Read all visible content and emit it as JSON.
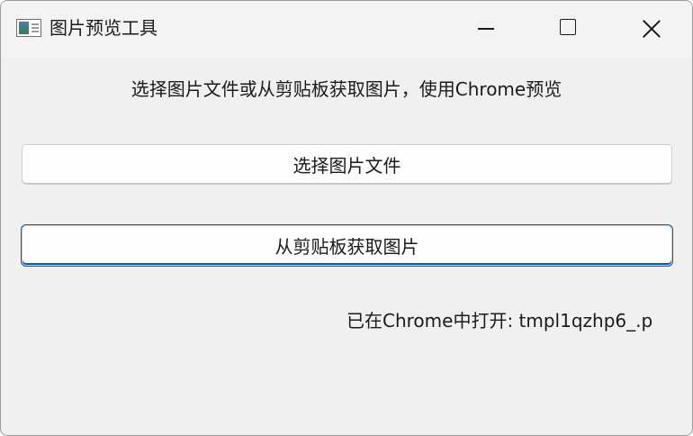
{
  "window": {
    "title": "图片预览工具",
    "icon": "image-viewer-app-icon",
    "controls": {
      "minimize": "minimize-icon",
      "maximize": "maximize-icon",
      "close": "close-icon"
    }
  },
  "main": {
    "instruction": "选择图片文件或从剪贴板获取图片，使用Chrome预览",
    "select_file_label": "选择图片文件",
    "clipboard_label": "从剪贴板获取图片",
    "status": "已在Chrome中打开: tmpl1qzhp6_.p"
  },
  "colors": {
    "window_bg": "#f0f0f0",
    "focus_accent": "#005fb8",
    "text": "#1a1a1a"
  }
}
